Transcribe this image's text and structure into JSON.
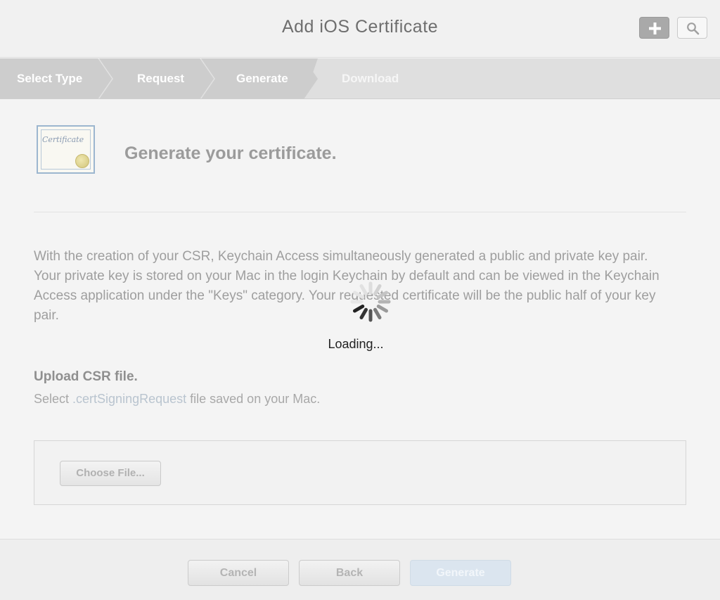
{
  "header": {
    "title": "Add iOS Certificate",
    "add_icon": "plus-icon",
    "search_icon": "search-icon"
  },
  "steps": [
    {
      "label": "Select Type",
      "state": "done"
    },
    {
      "label": "Request",
      "state": "done"
    },
    {
      "label": "Generate",
      "state": "current"
    },
    {
      "label": "Download",
      "state": "todo"
    }
  ],
  "content": {
    "cert_icon_text": "Certificate",
    "heading": "Generate your certificate.",
    "description": "With the creation of your CSR, Keychain Access simultaneously generated a public and private key pair. Your private key is stored on your Mac in the login Keychain by default and can be viewed in the Keychain Access application under the \"Keys\" category. Your requested certificate will be the public half of your key pair.",
    "upload_heading": "Upload CSR file.",
    "upload_sub_prefix": "Select ",
    "upload_sub_ext": ".certSigningRequest",
    "upload_sub_suffix": " file saved on your Mac.",
    "choose_file_label": "Choose File..."
  },
  "footer": {
    "cancel_label": "Cancel",
    "back_label": "Back",
    "generate_label": "Generate"
  },
  "overlay": {
    "loading_text": "Loading...",
    "spinner_icon": "spinner-icon"
  },
  "colors": {
    "step_done": "#c9c9c9",
    "step_todo": "#dfdfdf",
    "generate_disabled": "#dbe5ef"
  }
}
